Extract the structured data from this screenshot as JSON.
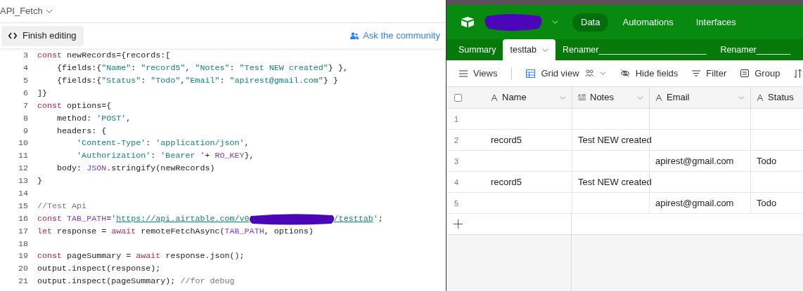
{
  "editor": {
    "script_name": "API_Fetch",
    "finish_button": "Finish editing",
    "community_link": "Ask the community",
    "lines": [
      {
        "number": "3",
        "tokens": [
          {
            "kind": "keyword",
            "text": "const"
          },
          {
            "kind": "plain",
            "text": " newRecords={records:["
          }
        ]
      },
      {
        "number": "4",
        "tokens": [
          {
            "kind": "plain",
            "text": "    {fields:{"
          },
          {
            "kind": "string",
            "text": "\"Name\""
          },
          {
            "kind": "plain",
            "text": ": "
          },
          {
            "kind": "string",
            "text": "\"record5\""
          },
          {
            "kind": "plain",
            "text": ", "
          },
          {
            "kind": "string",
            "text": "\"Notes\""
          },
          {
            "kind": "plain",
            "text": ": "
          },
          {
            "kind": "string",
            "text": "\"Test NEW created\""
          },
          {
            "kind": "plain",
            "text": "} },"
          }
        ]
      },
      {
        "number": "5",
        "tokens": [
          {
            "kind": "plain",
            "text": "    {fields:{"
          },
          {
            "kind": "string",
            "text": "\"Status\""
          },
          {
            "kind": "plain",
            "text": ": "
          },
          {
            "kind": "string",
            "text": "\"Todo\""
          },
          {
            "kind": "plain",
            "text": ","
          },
          {
            "kind": "string",
            "text": "\"Email\""
          },
          {
            "kind": "plain",
            "text": ": "
          },
          {
            "kind": "string",
            "text": "\"apirest@gmail.com\""
          },
          {
            "kind": "plain",
            "text": "} }"
          }
        ]
      },
      {
        "number": "6",
        "tokens": [
          {
            "kind": "plain",
            "text": "]}"
          }
        ]
      },
      {
        "number": "7",
        "tokens": [
          {
            "kind": "keyword",
            "text": "const"
          },
          {
            "kind": "plain",
            "text": " options={"
          }
        ]
      },
      {
        "number": "8",
        "tokens": [
          {
            "kind": "plain",
            "text": "    method: "
          },
          {
            "kind": "string",
            "text": "'POST'"
          },
          {
            "kind": "plain",
            "text": ","
          }
        ]
      },
      {
        "number": "9",
        "tokens": [
          {
            "kind": "plain",
            "text": "    headers: {"
          }
        ]
      },
      {
        "number": "10",
        "tokens": [
          {
            "kind": "string",
            "text": "        'Content-Type'"
          },
          {
            "kind": "plain",
            "text": ": "
          },
          {
            "kind": "string",
            "text": "'application/json'"
          },
          {
            "kind": "plain",
            "text": ","
          }
        ]
      },
      {
        "number": "11",
        "tokens": [
          {
            "kind": "string",
            "text": "        'Authorization'"
          },
          {
            "kind": "plain",
            "text": ": "
          },
          {
            "kind": "string",
            "text": "'Bearer '"
          },
          {
            "kind": "plain",
            "text": "+ "
          },
          {
            "kind": "variable",
            "text": "RO_KEY"
          },
          {
            "kind": "plain",
            "text": "},"
          }
        ]
      },
      {
        "number": "12",
        "tokens": [
          {
            "kind": "plain",
            "text": "    body: "
          },
          {
            "kind": "variable",
            "text": "JSON"
          },
          {
            "kind": "plain",
            "text": ".stringify(newRecords)"
          }
        ]
      },
      {
        "number": "13",
        "tokens": [
          {
            "kind": "plain",
            "text": "}"
          }
        ]
      },
      {
        "number": "14"
      },
      {
        "number": "15",
        "tokens": [
          {
            "kind": "comment",
            "text": "//Test Api"
          }
        ]
      },
      {
        "number": "16",
        "tokens": [
          {
            "kind": "keyword",
            "text": "const "
          },
          {
            "kind": "variable",
            "text": "TAB_PATH"
          },
          {
            "kind": "plain",
            "text": "="
          },
          {
            "kind": "string",
            "text": "'"
          },
          {
            "kind": "url",
            "text": "https://api.airtable.com/v0"
          },
          {
            "kind": "redaction"
          },
          {
            "kind": "url",
            "text": "/testtab"
          },
          {
            "kind": "string",
            "text": "'"
          },
          {
            "kind": "plain",
            "text": ";"
          }
        ]
      },
      {
        "number": "17",
        "tokens": [
          {
            "kind": "keyword",
            "text": "let"
          },
          {
            "kind": "plain",
            "text": " response = "
          },
          {
            "kind": "keyword",
            "text": "await"
          },
          {
            "kind": "plain",
            "text": " remoteFetchAsync("
          },
          {
            "kind": "variable",
            "text": "TAB_PATH"
          },
          {
            "kind": "plain",
            "text": ", options)"
          }
        ]
      },
      {
        "number": "18"
      },
      {
        "number": "19",
        "tokens": [
          {
            "kind": "keyword",
            "text": "const"
          },
          {
            "kind": "plain",
            "text": " pageSummary = "
          },
          {
            "kind": "keyword",
            "text": "await"
          },
          {
            "kind": "plain",
            "text": " response.json();"
          }
        ]
      },
      {
        "number": "20",
        "tokens": [
          {
            "kind": "plain",
            "text": "output.inspect(response);"
          }
        ]
      },
      {
        "number": "21",
        "tokens": [
          {
            "kind": "plain",
            "text": "output.inspect(pageSummary); "
          },
          {
            "kind": "comment",
            "text": "//for debug"
          }
        ]
      }
    ]
  },
  "base": {
    "nav": [
      {
        "label": "Data",
        "selected": true
      },
      {
        "label": "Automations",
        "selected": false
      },
      {
        "label": "Interfaces",
        "selected": false
      }
    ],
    "tables": [
      {
        "label": "Summary",
        "selected": false
      },
      {
        "label": "testtab",
        "selected": true
      },
      {
        "label": "Renamer______________________",
        "selected": false
      },
      {
        "label": "Renamer_______",
        "selected": false
      }
    ],
    "toolbar": {
      "views": "Views",
      "grid_view": "Grid view",
      "hide_fields": "Hide fields",
      "filter": "Filter",
      "group": "Group"
    },
    "select_all": {
      "checked": false
    },
    "columns": [
      {
        "label": "Name",
        "kind": "text"
      },
      {
        "label": "Notes",
        "kind": "longtext"
      },
      {
        "label": "Email",
        "kind": "text"
      },
      {
        "label": "Status",
        "kind": "text"
      }
    ],
    "rows": [
      {
        "number": "1",
        "cells": [
          "",
          "",
          "",
          ""
        ]
      },
      {
        "number": "2",
        "cells": [
          "record5",
          "Test NEW created",
          "",
          ""
        ]
      },
      {
        "number": "3",
        "cells": [
          "",
          "",
          "apirest@gmail.com",
          "Todo"
        ]
      },
      {
        "number": "4",
        "cells": [
          "record5",
          "Test NEW created",
          "",
          ""
        ]
      },
      {
        "number": "5",
        "cells": [
          "",
          "",
          "apirest@gmail.com",
          "Todo"
        ]
      }
    ]
  }
}
